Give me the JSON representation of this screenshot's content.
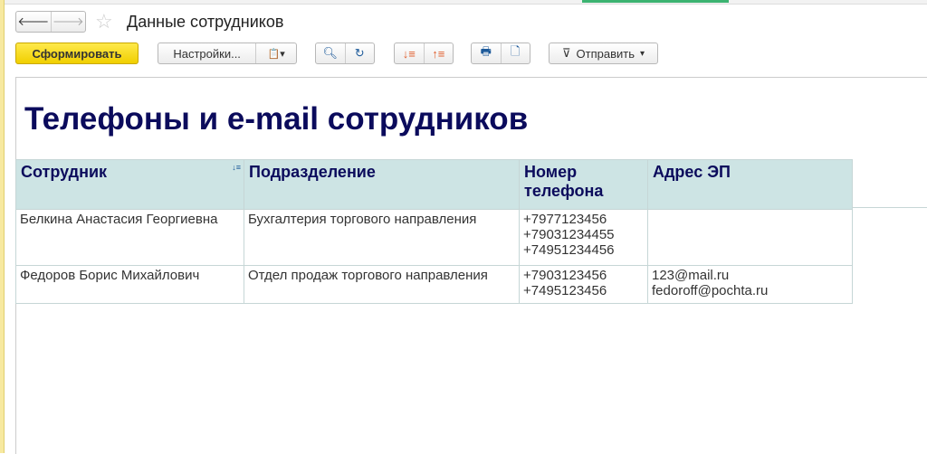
{
  "window": {
    "title": "Данные сотрудников"
  },
  "toolbar": {
    "generate": "Сформировать",
    "settings": "Настройки...",
    "send": "Отправить"
  },
  "report": {
    "title": "Телефоны и e-mail сотрудников",
    "columns": [
      "Сотрудник",
      "Подразделение",
      "Номер телефона",
      "Адрес ЭП"
    ],
    "rows": [
      {
        "employee": "Белкина Анастасия Георгиевна",
        "department": "Бухгалтерия торгового направления",
        "phones": [
          "+7977123456",
          "+79031234455",
          "+74951234456"
        ],
        "emails": []
      },
      {
        "employee": "Федоров Борис Михайлович",
        "department": "Отдел продаж торгового направления",
        "phones": [
          "+7903123456",
          "+7495123456"
        ],
        "emails": [
          "123@mail.ru",
          "fedoroff@pochta.ru"
        ]
      }
    ]
  },
  "colors": {
    "header_bg": "#cde4e4",
    "title": "#0b0b5c",
    "primary_button": "#f5d800"
  }
}
